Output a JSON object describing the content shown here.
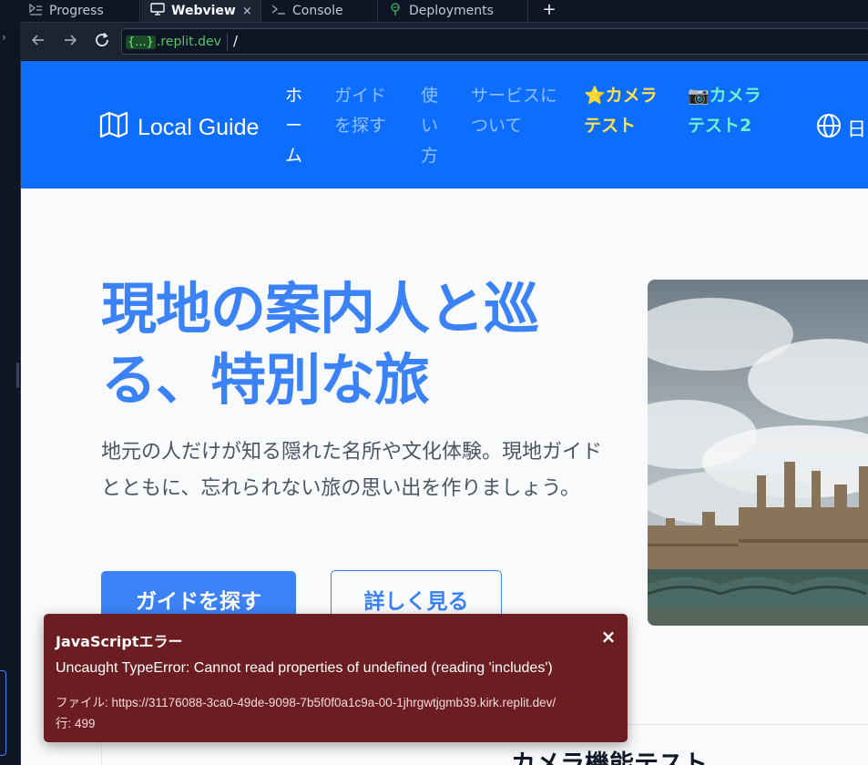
{
  "ide": {
    "tabs": [
      {
        "label": "Progress",
        "icon": "progress-icon"
      },
      {
        "label": "Webview",
        "icon": "monitor-icon",
        "close": "×"
      },
      {
        "label": "Console",
        "icon": "terminal-icon"
      },
      {
        "label": "Deployments",
        "icon": "deployments-icon"
      }
    ],
    "add_tab": "+",
    "url": {
      "host_badge": "{...}",
      "host_domain": ".replit.dev",
      "path": "/"
    }
  },
  "site": {
    "brand": "Local Guide",
    "nav": {
      "home": "ホーム",
      "find_guide": "ガイドを探す",
      "how_to": "使い方",
      "about": "サービスについて",
      "camera_test": "⭐カメラテスト",
      "camera_test2": "📷カメラテスト2",
      "language": "日"
    },
    "hero": {
      "title": "現地の案内人と巡る、特別な旅",
      "subtitle": "地元の人だけが知る隠れた名所や文化体験。現地ガイドとともに、忘れられない旅の思い出を作りましょう。",
      "primary_button": "ガイドを探す",
      "secondary_button": "詳しく見る"
    },
    "lower_section_title": "カメラ機能テスト"
  },
  "error": {
    "title": "JavaScriptエラー",
    "close": "×",
    "message": "Uncaught TypeError: Cannot read properties of undefined (reading 'includes')",
    "file_label": "ファイル:",
    "file_url": "https://31176088-3ca0-49de-9098-7b5f0f0a1c9a-00-1jhrgwtjgmb39.kirk.replit.dev/",
    "line_label": "行:",
    "line": "499"
  },
  "colors": {
    "header_blue": "#0d6efd",
    "accent_blue": "#3b82f6",
    "error_bg": "#6b1d22",
    "nav_yellow": "#ffe14d",
    "nav_green": "#72f0c7"
  }
}
